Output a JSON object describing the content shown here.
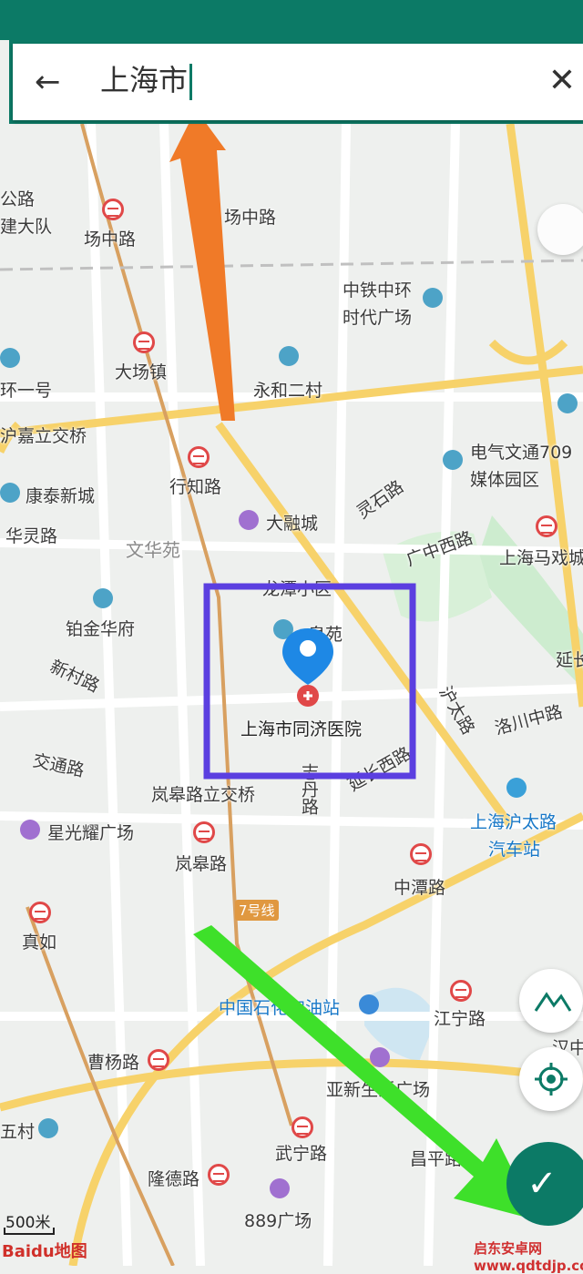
{
  "search": {
    "query": "上海市",
    "back_icon": "arrow-left-icon",
    "clear_icon": "close-icon"
  },
  "map": {
    "labels": {
      "changzhong_metro": "场中路",
      "changzhong_road": "场中路",
      "gonglu": "公路",
      "dadui": "建大队",
      "zhongtie": "中铁中环",
      "shidai": "时代广场",
      "dachang": "大场镇",
      "yonghe": "永和二村",
      "huanyihao": "环一号",
      "jiadinglijiao": "沪嘉立交桥",
      "dianqi": "电气文通709",
      "meiti": "媒体园区",
      "kangtai": "康泰新城",
      "xingzhi": "行知路",
      "lingshi": "灵石路",
      "huaning": "华灵路",
      "darongcheng": "大融城",
      "guangzhongxi": "广中西路",
      "wenhuayuan": "文华苑",
      "mahxi": "上海马戏城",
      "taicang": "龙潭小区",
      "jinhua": "铂金华府",
      "quanyuan": "泉苑",
      "yan": "延长",
      "xincun": "新村路",
      "hutai": "沪太路",
      "hospital": "上海市同济医院",
      "luochuan": "洛川中路",
      "jiaotong": "交通路",
      "lanyuelijiao": "岚皋路立交桥",
      "zhidan": "志丹路",
      "yanchangxi": "延长西路",
      "hutaibus": "上海沪太路",
      "bus_station": "汽车站",
      "xingguang": "星光耀广场",
      "langao": "岚皋路",
      "zhongtan": "中潭路",
      "zhenru": "真如",
      "line7": "7号线",
      "sinopec": "中国石化加油站",
      "jiangning": "江宁路",
      "caoyang": "曹杨路",
      "yaxin": "亚新生活广场",
      "hanzhong": "汉中",
      "wucun": "五村",
      "wuning": "武宁路",
      "longde": "隆德路",
      "changping": "昌平路",
      "guangchang889": "889广场"
    },
    "scale": "500米",
    "brand": "Baidu地图",
    "watermark": "启东安卓网 www.qdtdjp.com"
  },
  "colors": {
    "accent": "#0c7a66",
    "marker": "#1e88e5",
    "highlight_box": "#5b3fe0",
    "arrow_orange": "#f07a28",
    "arrow_green": "#3ee02a"
  }
}
